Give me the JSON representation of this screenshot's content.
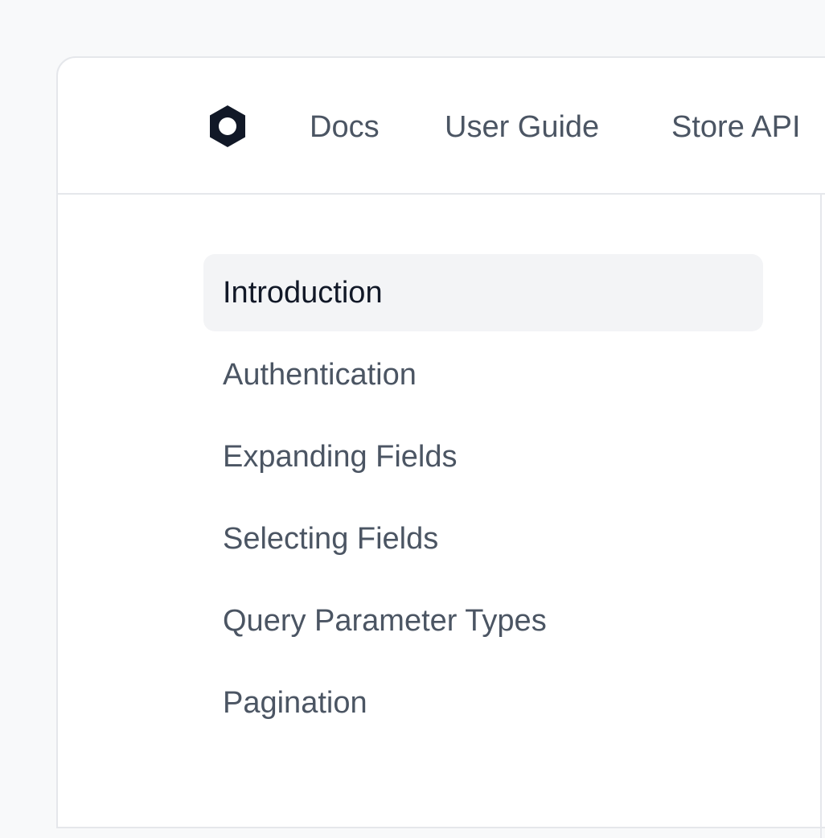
{
  "colors": {
    "background": "#f8f9fa",
    "panel": "#ffffff",
    "border": "#e5e7eb",
    "text_muted": "#4b5563",
    "text_active": "#111827",
    "active_item_bg": "#f3f4f6",
    "logo": "#111827"
  },
  "header": {
    "logo_icon": "hexagon-ring-logo-icon",
    "nav": [
      {
        "label": "Docs"
      },
      {
        "label": "User Guide"
      },
      {
        "label": "Store API"
      }
    ]
  },
  "sidebar": {
    "active_index": 0,
    "items": [
      {
        "label": "Introduction"
      },
      {
        "label": "Authentication"
      },
      {
        "label": "Expanding Fields"
      },
      {
        "label": "Selecting Fields"
      },
      {
        "label": "Query Parameter Types"
      },
      {
        "label": "Pagination"
      }
    ]
  }
}
